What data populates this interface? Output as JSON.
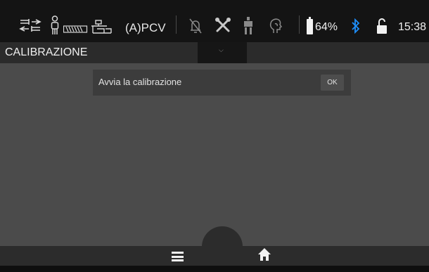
{
  "status": {
    "mode": "(A)PCV",
    "battery": "64%",
    "time": "15:38",
    "icons": [
      "tube-connection-icon",
      "patient-icon",
      "humidifier-hose-icon",
      "circuit-icon",
      "alarm-mute-icon",
      "tools-icon",
      "service-icon",
      "head-profile-icon",
      "battery-icon",
      "bluetooth-icon",
      "unlock-icon"
    ]
  },
  "header": {
    "title": "CALIBRAZIONE"
  },
  "message": {
    "text": "Avvia la calibrazione",
    "button": "OK"
  },
  "nav": {
    "icons": [
      "menu-icon",
      "home-icon"
    ]
  },
  "colors": {
    "accent_bluetooth": "#1e90ff",
    "background": "#4b4b4b",
    "bar": "#2c2c2c"
  }
}
